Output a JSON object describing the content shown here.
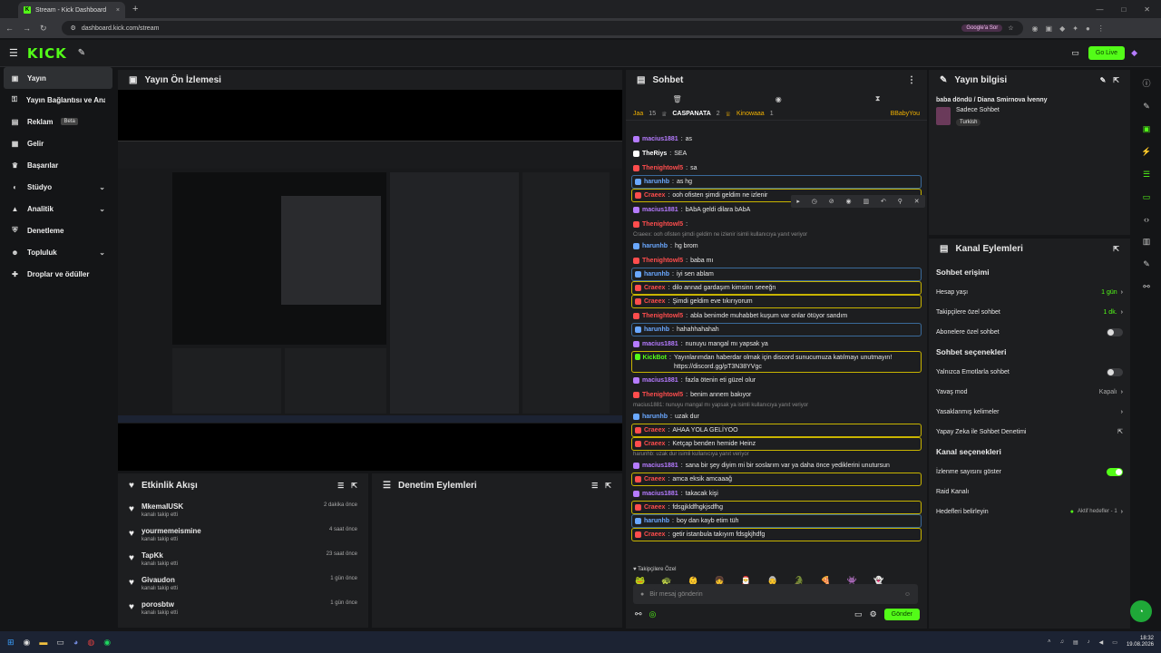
{
  "browser": {
    "tab_title": "Stream - Kick Dashboard",
    "tab_close": "×",
    "new_tab": "+",
    "url": "dashboard.kick.com/stream",
    "google_sor": "Google'a Sor",
    "window_controls": [
      "—",
      "□",
      "✕"
    ]
  },
  "header": {
    "logo": "KICK",
    "go_live": "Go Live"
  },
  "sidebar": {
    "items": [
      {
        "label": "Yayın",
        "icon": "broadcast-icon",
        "active": true
      },
      {
        "label": "Yayın Bağlantısı ve Anahtarı",
        "icon": "link-icon"
      },
      {
        "label": "Reklam",
        "icon": "ad-icon",
        "badge": "Beta"
      },
      {
        "label": "Gelir",
        "icon": "wallet-icon"
      },
      {
        "label": "Başarılar",
        "icon": "trophy-icon"
      },
      {
        "label": "Stüdyo",
        "icon": "studio-icon",
        "expand": "⌄"
      },
      {
        "label": "Analitik",
        "icon": "chart-icon",
        "expand": "⌄"
      },
      {
        "label": "Denetleme",
        "icon": "shield-icon"
      },
      {
        "label": "Topluluk",
        "icon": "people-icon",
        "expand": "⌄"
      },
      {
        "label": "Droplar ve ödüller",
        "icon": "gift-icon"
      }
    ]
  },
  "preview": {
    "title": "Yayın Ön İzlemesi"
  },
  "activity": {
    "title": "Etkinlik Akışı",
    "items": [
      {
        "name": "MkemalUSK",
        "action": "kanalı takip etti",
        "time": "2 dakika önce"
      },
      {
        "name": "yourmemeismine",
        "action": "kanalı takip etti",
        "time": "4 saat önce"
      },
      {
        "name": "TapKk",
        "action": "kanalı takip etti",
        "time": "23 saat önce"
      },
      {
        "name": "Givaudon",
        "action": "kanalı takip etti",
        "time": "1 gün önce"
      },
      {
        "name": "porosbtw",
        "action": "kanalı takip etti",
        "time": "1 gün önce"
      }
    ]
  },
  "moderation": {
    "title": "Denetim Eylemleri"
  },
  "chat": {
    "title": "Sohbet",
    "leaderboard": [
      {
        "name": "Jaa",
        "count": "15"
      },
      {
        "name": "CASPANATA",
        "count": "2"
      },
      {
        "name": "Kinowaaa",
        "count": "1"
      },
      {
        "name": "BBabyYou",
        "count": ""
      }
    ],
    "messages": [
      {
        "user": "macius1881",
        "color": "#b57bff",
        "text": "as",
        "style": ""
      },
      {
        "user": "TheRiys",
        "color": "#ffffff",
        "text": "SEA",
        "style": ""
      },
      {
        "user": "Thenightowl5",
        "color": "#ff4d4d",
        "text": "sa",
        "style": ""
      },
      {
        "user": "harunhb",
        "color": "#6aa8ff",
        "text": "as hg",
        "style": "hl2"
      },
      {
        "user": "Craeex",
        "color": "#ff4d4d",
        "text": "ooh ofisten şimdi geldim ne izlenir",
        "style": "hl"
      },
      {
        "user": "macius1881",
        "color": "#b57bff",
        "text": "bAbA geldi dilara bAbA",
        "style": ""
      },
      {
        "user": "Thenightowl5",
        "color": "#ff4d4d",
        "text": "",
        "style": ""
      },
      {
        "user": "harunhb",
        "color": "#6aa8ff",
        "text": "hg brom",
        "style": "",
        "reply": "Craeex: ooh ofisten şimdi geldim ne izlenir isimli kullanıcıya yanıt veriyor"
      },
      {
        "user": "Thenightowl5",
        "color": "#ff4d4d",
        "text": "baba mı",
        "style": ""
      },
      {
        "user": "harunhb",
        "color": "#6aa8ff",
        "text": "iyi sen ablam",
        "style": "hl2"
      },
      {
        "user": "Craeex",
        "color": "#ff4d4d",
        "text": "dilo annad gardaşım kimsinn seeeğn",
        "style": "hl"
      },
      {
        "user": "Craeex",
        "color": "#ff4d4d",
        "text": "Şimdi geldim eve tıkırıyorum",
        "style": "hl"
      },
      {
        "user": "Thenightowl5",
        "color": "#ff4d4d",
        "text": "abla benimde muhabbet kuşum var onlar ötüyor sandım",
        "style": ""
      },
      {
        "user": "harunhb",
        "color": "#6aa8ff",
        "text": "hahahhahahah",
        "style": "hl2"
      },
      {
        "user": "macius1881",
        "color": "#b57bff",
        "text": "nunuyu mangal mı yapsak ya",
        "style": ""
      },
      {
        "user": "KickBot",
        "color": "#53fc18",
        "text": "Yayınlarımdan haberdar olmak için discord sunucumuza katılmayı unutmayın! https://discord.gg/pT3N38YVgc",
        "style": "hl tall"
      },
      {
        "user": "macius1881",
        "color": "#b57bff",
        "text": "fazla ötenin eti güzel olur",
        "style": ""
      },
      {
        "user": "Thenightowl5",
        "color": "#ff4d4d",
        "text": "benim annem bakıyor",
        "style": ""
      },
      {
        "user": "harunhb",
        "color": "#6aa8ff",
        "text": "uzak dur",
        "style": "",
        "reply": "macius1881: nunuyu mangal mı yapsak ya isimli kullanıcıya yanıt veriyor"
      },
      {
        "user": "Craeex",
        "color": "#ff4d4d",
        "text": "AHAA YOLA GELİYOO",
        "style": "hl"
      },
      {
        "user": "Craeex",
        "color": "#ff4d4d",
        "text": "Ketçap benden hemide Heinz",
        "style": "hl"
      },
      {
        "user": "macius1881",
        "color": "#b57bff",
        "text": "sana bir şey diyim mi bir soslarım var ya daha önce yediklerini unutursun",
        "style": "",
        "reply": "harunhb: uzak dur isimli kullanıcıya yanıt veriyor"
      },
      {
        "user": "Craeex",
        "color": "#ff4d4d",
        "text": "amca eksik amcaaağ",
        "style": "hl"
      },
      {
        "user": "macius1881",
        "color": "#b57bff",
        "text": "takacak kişi",
        "style": ""
      },
      {
        "user": "Craeex",
        "color": "#ff4d4d",
        "text": "fdsgjkldfhgkjsdfhg",
        "style": "hl"
      },
      {
        "user": "harunhb",
        "color": "#6aa8ff",
        "text": "boy dan kayb etim tüh",
        "style": "hl2"
      },
      {
        "user": "Craeex",
        "color": "#ff4d4d",
        "text": "getir istanbula takıyım fdsgkjhdfg",
        "style": "hl"
      }
    ],
    "emotes_label": "Takipçilere Özel",
    "input_placeholder": "Bir mesaj gönderin",
    "send": "Gönder"
  },
  "stream_info": {
    "title": "Yayın bilgisi",
    "stream_title": "baba döndü / Diana Smirnova İvenny",
    "category": "Sadece Sohbet",
    "tag": "Turkish"
  },
  "channel_actions": {
    "title": "Kanal Eylemleri",
    "chat_access": "Sohbet erişimi",
    "account_age": {
      "label": "Hesap yaşı",
      "value": "1 gün"
    },
    "followers_only": {
      "label": "Takipçilere özel sohbet",
      "value": "1 dk."
    },
    "subs_only": {
      "label": "Abonelere özel sohbet",
      "on": false
    },
    "chat_options": "Sohbet seçenekleri",
    "emote_only": {
      "label": "Yalnızca Emotlarla sohbet",
      "on": false
    },
    "slow_mode": {
      "label": "Yavaş mod",
      "value": "Kapalı"
    },
    "banned_words": {
      "label": "Yasaklanmış kelimeler"
    },
    "ai_mod": {
      "label": "Yapay Zeka ile Sohbet Denetimi"
    },
    "channel_options": "Kanal seçenekleri",
    "viewer_count": {
      "label": "İzlenme sayısını göster",
      "on": true
    },
    "raid": {
      "label": "Raid Kanalı"
    },
    "goals": {
      "label": "Hedefleri belirleyin",
      "value": "Aktif hedefler - 1"
    }
  },
  "taskbar": {
    "time": "18:32",
    "date": "19.08.2026"
  }
}
